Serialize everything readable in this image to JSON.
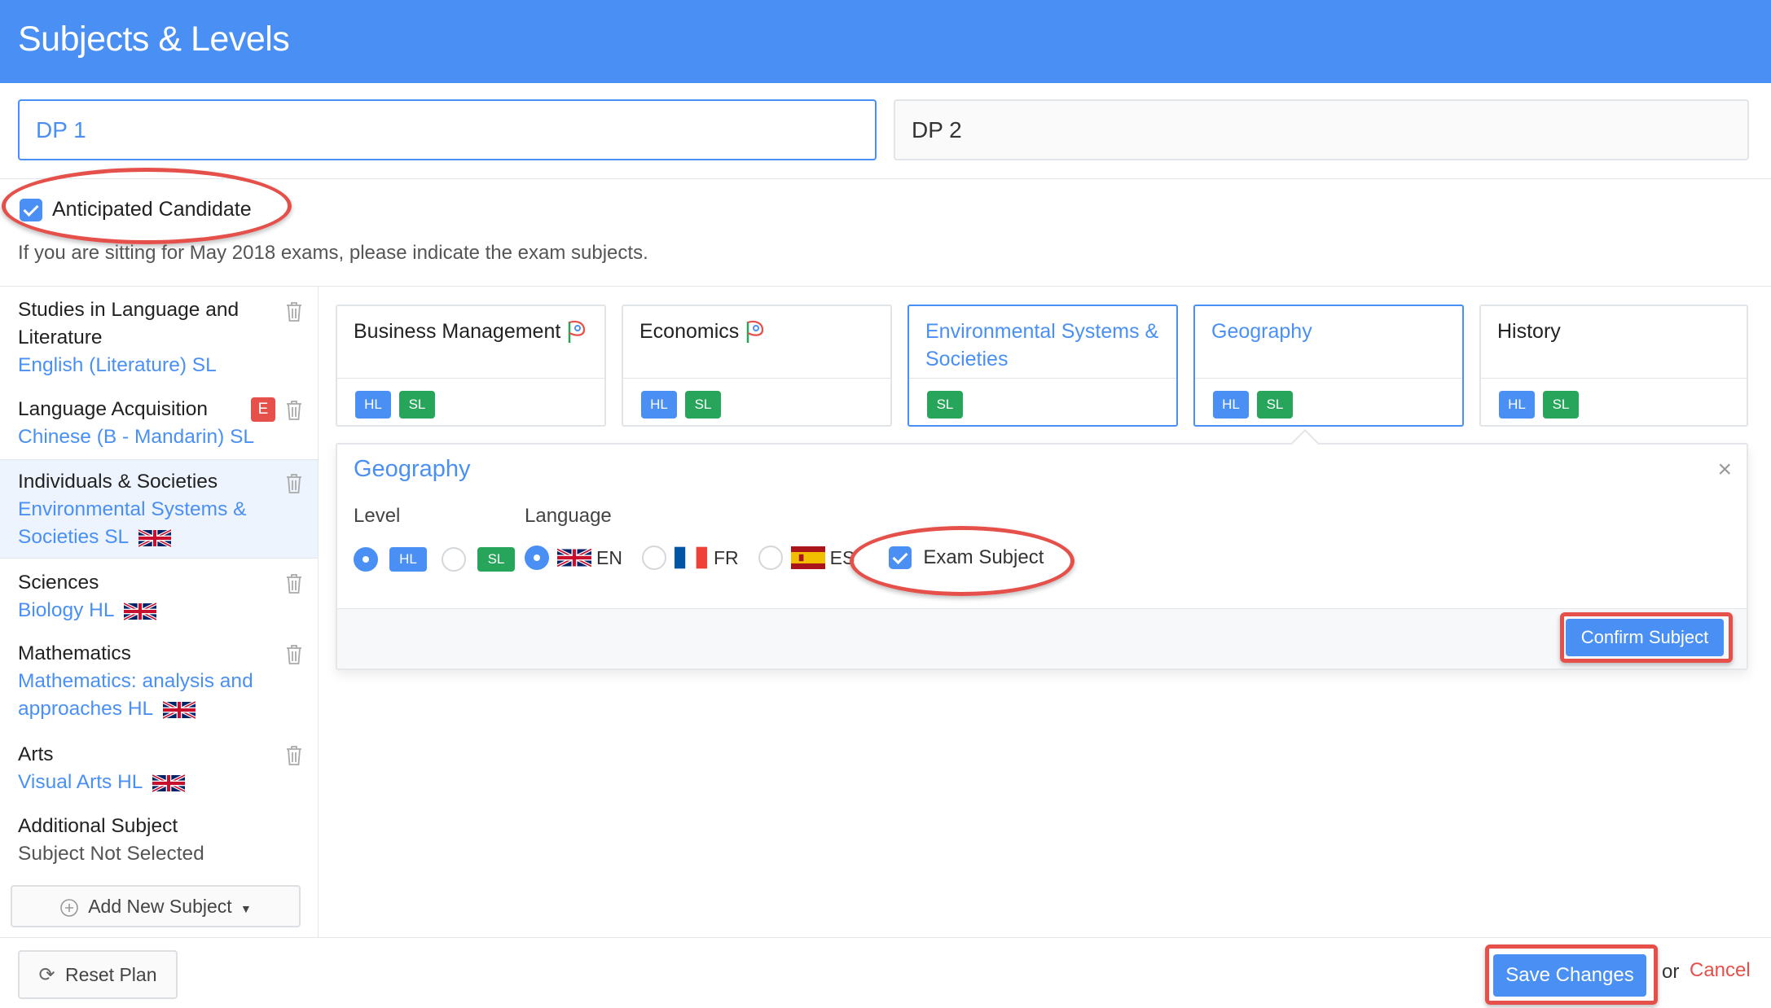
{
  "header": {
    "title": "Subjects & Levels"
  },
  "tabs": [
    {
      "label": "DP 1",
      "active": true
    },
    {
      "label": "DP 2",
      "active": false
    }
  ],
  "anticipated": {
    "label": "Anticipated Candidate",
    "checked": true
  },
  "help_text": "If you are sitting for May 2018 exams, please indicate the exam subjects.",
  "sidebar": {
    "items": [
      {
        "group": "Studies in Language and",
        "group2": "Literature",
        "subject": "English (Literature) SL",
        "flag": ""
      },
      {
        "group": "Language Acquisition",
        "subject": "Chinese (B - Mandarin) SL",
        "badge": "E"
      },
      {
        "group": "Individuals & Societies",
        "subject": "Environmental Systems &",
        "subject2": "Societies SL",
        "flag": "uk-flag"
      },
      {
        "group": "Sciences",
        "subject": "Biology HL",
        "flag": "uk-flag"
      },
      {
        "group": "Mathematics",
        "subject": "Mathematics: analysis and",
        "subject2": "approaches HL",
        "flag": "uk-flag"
      },
      {
        "group": "Arts",
        "subject": "Visual Arts HL",
        "flag": "uk-flag"
      },
      {
        "group": "Additional Subject",
        "subject": "Subject Not Selected"
      }
    ],
    "add_button": "Add New Subject"
  },
  "cards": [
    {
      "title": "Business Management",
      "levels": [
        "HL",
        "SL"
      ],
      "icon": "pin-icon"
    },
    {
      "title": "Economics",
      "levels": [
        "HL",
        "SL"
      ],
      "icon": "pin-icon"
    },
    {
      "title": "Environmental Systems &",
      "title2": "Societies",
      "levels": [
        "SL"
      ]
    },
    {
      "title": "Geography",
      "levels": [
        "HL",
        "SL"
      ]
    },
    {
      "title": "History",
      "levels": [
        "HL",
        "SL"
      ]
    }
  ],
  "detail": {
    "title": "Geography",
    "level_label": "Level",
    "language_label": "Language",
    "levels": [
      "HL",
      "SL"
    ],
    "selected_level": "HL",
    "languages": [
      "EN",
      "FR",
      "ES"
    ],
    "selected_language": "EN",
    "exam_subject_label": "Exam Subject",
    "exam_subject_checked": true,
    "confirm_button": "Confirm Subject"
  },
  "footer": {
    "reset_button": "Reset Plan",
    "save_button": "Save Changes",
    "or_text": "or",
    "cancel_link": "Cancel"
  },
  "colors": {
    "primary": "#4a90f4",
    "success": "#27a55a",
    "danger": "#e5504a"
  }
}
